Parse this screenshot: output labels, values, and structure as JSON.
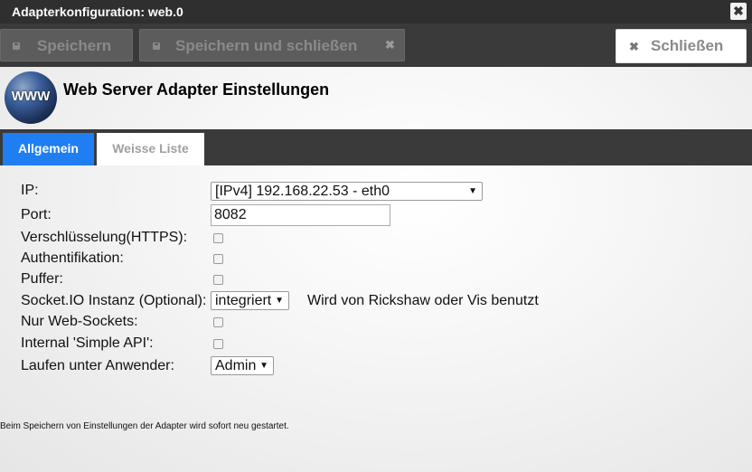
{
  "window": {
    "title": "Adapterkonfiguration: web.0",
    "close_glyph": "✖"
  },
  "toolbar": {
    "save_label": "Speichern",
    "save_close_label": "Speichern und schließen",
    "close_label": "Schließen",
    "x_glyph": "✖"
  },
  "header": {
    "logo_text": "WWW",
    "title": "Web Server Adapter Einstellungen"
  },
  "tabs": [
    {
      "label": "Allgemein",
      "active": true
    },
    {
      "label": "Weisse Liste",
      "active": false
    }
  ],
  "form": {
    "ip": {
      "label": "IP:",
      "value": "[IPv4] 192.168.22.53 - eth0"
    },
    "port": {
      "label": "Port:",
      "value": "8082"
    },
    "https": {
      "label": "Verschlüsselung(HTTPS):",
      "checked": false
    },
    "auth": {
      "label": "Authentifikation:",
      "checked": false
    },
    "buffer": {
      "label": "Puffer:",
      "checked": false
    },
    "socketio": {
      "label": "Socket.IO Instanz (Optional):",
      "value": "integriert",
      "note": "Wird von Rickshaw oder Vis benutzt"
    },
    "websockets": {
      "label": "Nur Web-Sockets:",
      "checked": false
    },
    "simpleapi": {
      "label": "Internal 'Simple API':",
      "checked": false
    },
    "runas": {
      "label": "Laufen unter Anwender:",
      "value": "Admin"
    }
  },
  "footer": {
    "text": "Beim Speichern von Einstellungen der Adapter wird sofort neu gestartet."
  },
  "colors": {
    "accent": "#1f7ef2",
    "bar": "#3a3a3a",
    "titlebar": "#2f2f2f"
  },
  "icons": {
    "dropdown": "▼"
  }
}
